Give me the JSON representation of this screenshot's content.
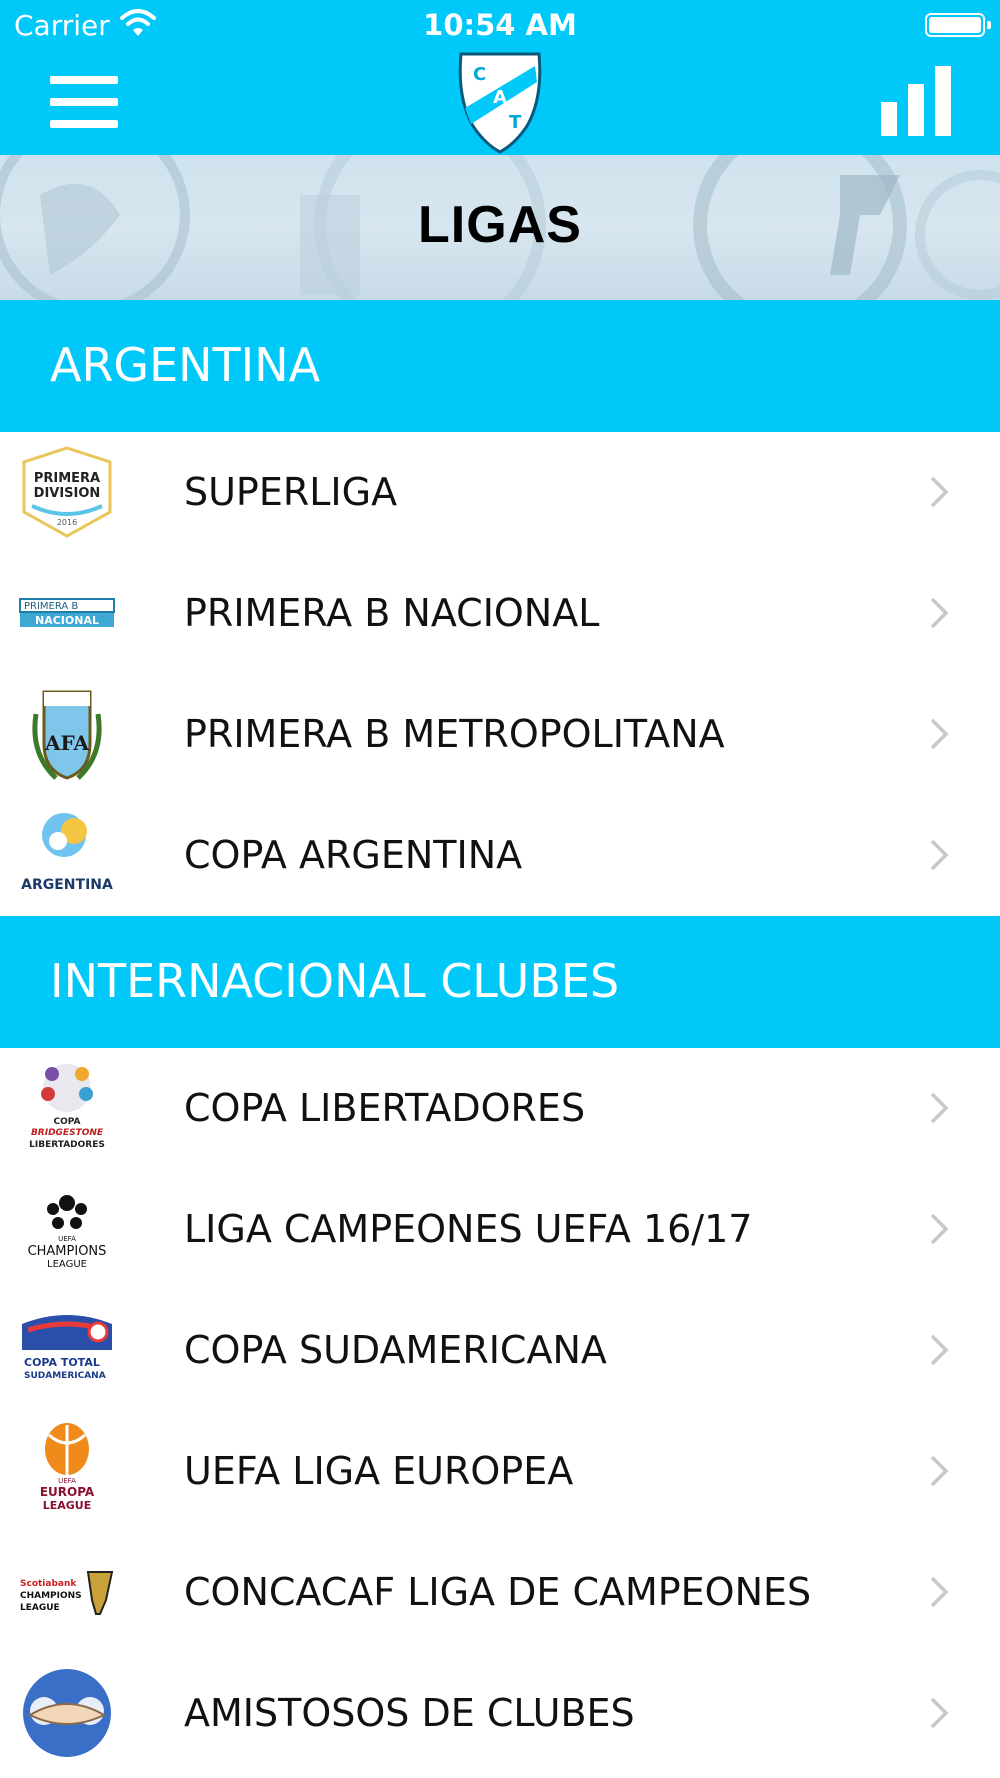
{
  "status_bar": {
    "carrier": "Carrier",
    "time": "10:54 AM"
  },
  "nav": {
    "crest_letters": [
      "C",
      "A",
      "T"
    ],
    "menu_icon": "hamburger-menu-icon",
    "stats_icon": "bar-chart-icon"
  },
  "page": {
    "title": "LIGAS"
  },
  "sections": [
    {
      "label": "ARGENTINA",
      "items": [
        {
          "label": "SUPERLIGA",
          "logo": "primera-division-logo",
          "logo_text": [
            "PRIMERA",
            "DIVISION",
            "2016"
          ]
        },
        {
          "label": "PRIMERA B NACIONAL",
          "logo": "primera-b-nacional-logo",
          "logo_text": [
            "PRIMERA B",
            "NACIONAL"
          ]
        },
        {
          "label": "PRIMERA B METROPOLITANA",
          "logo": "afa-logo",
          "logo_text": [
            "AFA"
          ]
        },
        {
          "label": "COPA ARGENTINA",
          "logo": "copa-argentina-logo",
          "logo_text": [
            "ARGENTINA"
          ]
        }
      ]
    },
    {
      "label": "INTERNACIONAL CLUBES",
      "items": [
        {
          "label": "COPA LIBERTADORES",
          "logo": "copa-libertadores-logo",
          "logo_text": [
            "COPA",
            "BRIDGESTONE",
            "LIBERTADORES"
          ]
        },
        {
          "label": "LIGA CAMPEONES UEFA 16/17",
          "logo": "champions-league-logo",
          "logo_text": [
            "UEFA",
            "CHAMPIONS",
            "LEAGUE"
          ]
        },
        {
          "label": "COPA SUDAMERICANA",
          "logo": "copa-sudamericana-logo",
          "logo_text": [
            "COPA TOTAL",
            "SUDAMERICANA"
          ]
        },
        {
          "label": "UEFA LIGA EUROPEA",
          "logo": "europa-league-logo",
          "logo_text": [
            "UEFA",
            "EUROPA",
            "LEAGUE"
          ]
        },
        {
          "label": "CONCACAF LIGA DE CAMPEONES",
          "logo": "concacaf-champions-logo",
          "logo_text": [
            "Scotiabank",
            "CHAMPIONS",
            "LEAGUE"
          ]
        },
        {
          "label": "AMISTOSOS DE CLUBES",
          "logo": "amistosos-logo",
          "logo_text": []
        }
      ]
    }
  ],
  "colors": {
    "accent": "#00c9f9",
    "chevron": "#c7c7cc"
  }
}
